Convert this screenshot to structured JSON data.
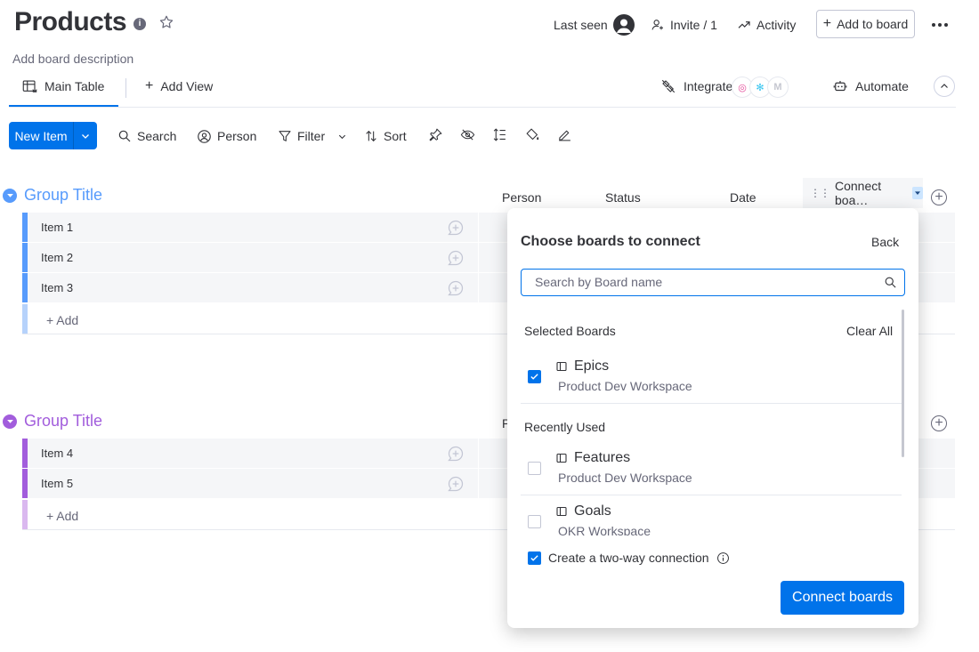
{
  "header": {
    "title": "Products",
    "info_glyph": "i",
    "description": "Add board description",
    "last_seen": "Last seen",
    "invite": "Invite / 1",
    "activity": "Activity",
    "add_to_board": "Add to board"
  },
  "views": {
    "main_table": "Main Table",
    "add_view": "Add View",
    "integrate": "Integrate",
    "automate": "Automate"
  },
  "toolbar": {
    "new_item": "New Item",
    "search": "Search",
    "person": "Person",
    "filter": "Filter",
    "sort": "Sort"
  },
  "columns": {
    "person": "Person",
    "status": "Status",
    "date": "Date",
    "connect": "Connect boa…",
    "person_partial": "P"
  },
  "groups": [
    {
      "title": "Group Title",
      "color": "#579bfc",
      "items": [
        "Item 1",
        "Item 2",
        "Item 3"
      ],
      "add_label": "+ Add"
    },
    {
      "title": "Group Title",
      "color": "#a25ddc",
      "items": [
        "Item 4",
        "Item 5"
      ],
      "add_label": "+ Add"
    }
  ],
  "popup": {
    "title": "Choose boards to connect",
    "back": "Back",
    "search_placeholder": "Search by Board name",
    "selected_label": "Selected Boards",
    "clear_all": "Clear All",
    "recent_label": "Recently Used",
    "boards": [
      {
        "name": "Epics",
        "workspace": "Product Dev Workspace",
        "checked": true
      },
      {
        "name": "Features",
        "workspace": "Product Dev Workspace",
        "checked": false
      },
      {
        "name": "Goals",
        "workspace": "OKR Workspace",
        "checked": false
      }
    ],
    "two_way": "Create a two-way connection",
    "two_way_checked": true,
    "connect_button": "Connect boards"
  },
  "colors": {
    "primary": "#0073ea",
    "group1": "#579bfc",
    "group2": "#a25ddc"
  }
}
